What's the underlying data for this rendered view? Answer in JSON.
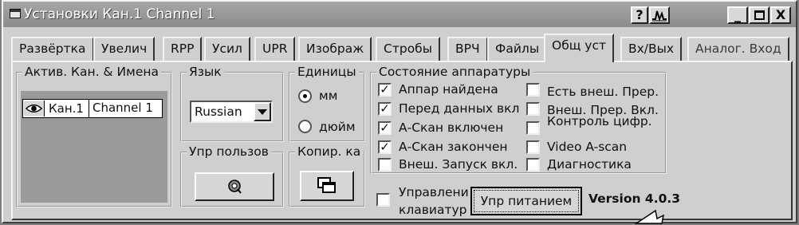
{
  "window": {
    "title": "Установки Кан.1 Channel 1",
    "help_label": "?",
    "chart_label": "/\\/\\",
    "minimize_label": "_",
    "maximize_label": "□",
    "close_label": "X"
  },
  "tabs": [
    {
      "label": "Развёртка"
    },
    {
      "label": "Увелич"
    },
    {
      "label": "RPP"
    },
    {
      "label": "Усил"
    },
    {
      "label": "UPR"
    },
    {
      "label": "Изображ"
    },
    {
      "label": "Стробы"
    },
    {
      "label": "ВРЧ"
    },
    {
      "label": "Файлы"
    },
    {
      "label": "Общ уст",
      "active": true
    },
    {
      "label": "Вх/Вых"
    },
    {
      "label": "Аналог. Вход"
    }
  ],
  "channels": {
    "title": "Актив. Кан. & Имена",
    "items": [
      {
        "id": "Кан.1",
        "name": "Channel 1",
        "icon": "eye-icon"
      }
    ]
  },
  "language": {
    "title": "Язык",
    "selected": "Russian"
  },
  "units": {
    "title": "Единицы",
    "options": [
      {
        "label": "мм",
        "selected": true
      },
      {
        "label": "дюйм",
        "selected": false
      }
    ]
  },
  "hardware": {
    "title": "Состояние аппаратуры",
    "left": [
      {
        "label": "Аппар найдена",
        "checked": true
      },
      {
        "label": "Перед данных вкл",
        "checked": true
      },
      {
        "label": "А-Скан включен",
        "checked": true
      },
      {
        "label": "А-Скан закончен",
        "checked": true
      },
      {
        "label": "Внеш. Запуск вкл.",
        "checked": false
      }
    ],
    "right": [
      {
        "label": "Есть внеш. Прер.",
        "checked": false
      },
      {
        "label": "Внеш. Прер. Вкл.",
        "checked": false
      },
      {
        "label": "Контроль цифр.",
        "checked": false
      },
      {
        "label": "Video A-scan",
        "checked": false
      },
      {
        "label": "Диагностика",
        "checked": false
      }
    ]
  },
  "user_mgmt": {
    "title": "Упр пользов",
    "icon": "user-management-icon"
  },
  "copy": {
    "title": "Копир. ка",
    "icon": "copy-windows-icon"
  },
  "keyboard": {
    "line1": "Управлени",
    "line2": "клавиатур",
    "checked": false
  },
  "power_button": "Упр питанием",
  "version": "Version 4.0.3"
}
